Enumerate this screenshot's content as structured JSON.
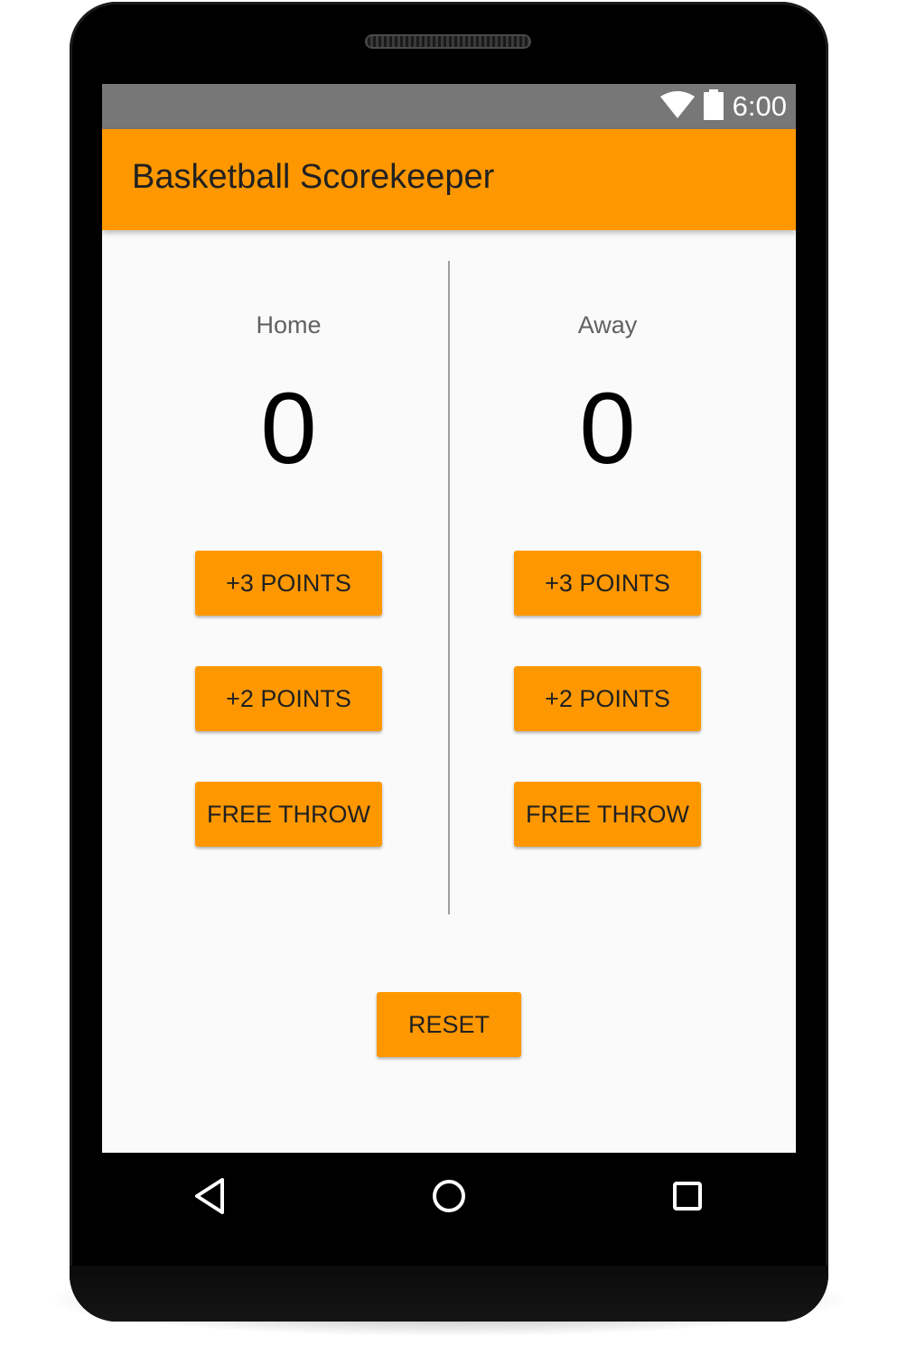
{
  "status_bar": {
    "time": "6:00",
    "icons": [
      "wifi-icon",
      "battery-icon"
    ]
  },
  "app_bar": {
    "title": "Basketball Scorekeeper"
  },
  "teams": [
    {
      "name": "Home",
      "score": "0",
      "buttons": {
        "three": "+3 POINTS",
        "two": "+2 POINTS",
        "free_throw": "FREE THROW"
      }
    },
    {
      "name": "Away",
      "score": "0",
      "buttons": {
        "three": "+3 POINTS",
        "two": "+2 POINTS",
        "free_throw": "FREE THROW"
      }
    }
  ],
  "reset_label": "RESET",
  "nav_bar": {
    "icons": [
      "back-icon",
      "home-icon",
      "recents-icon"
    ]
  },
  "colors": {
    "accent": "#ff9800",
    "status_bar": "#777777",
    "background": "#fafafa",
    "text": "#212121"
  }
}
